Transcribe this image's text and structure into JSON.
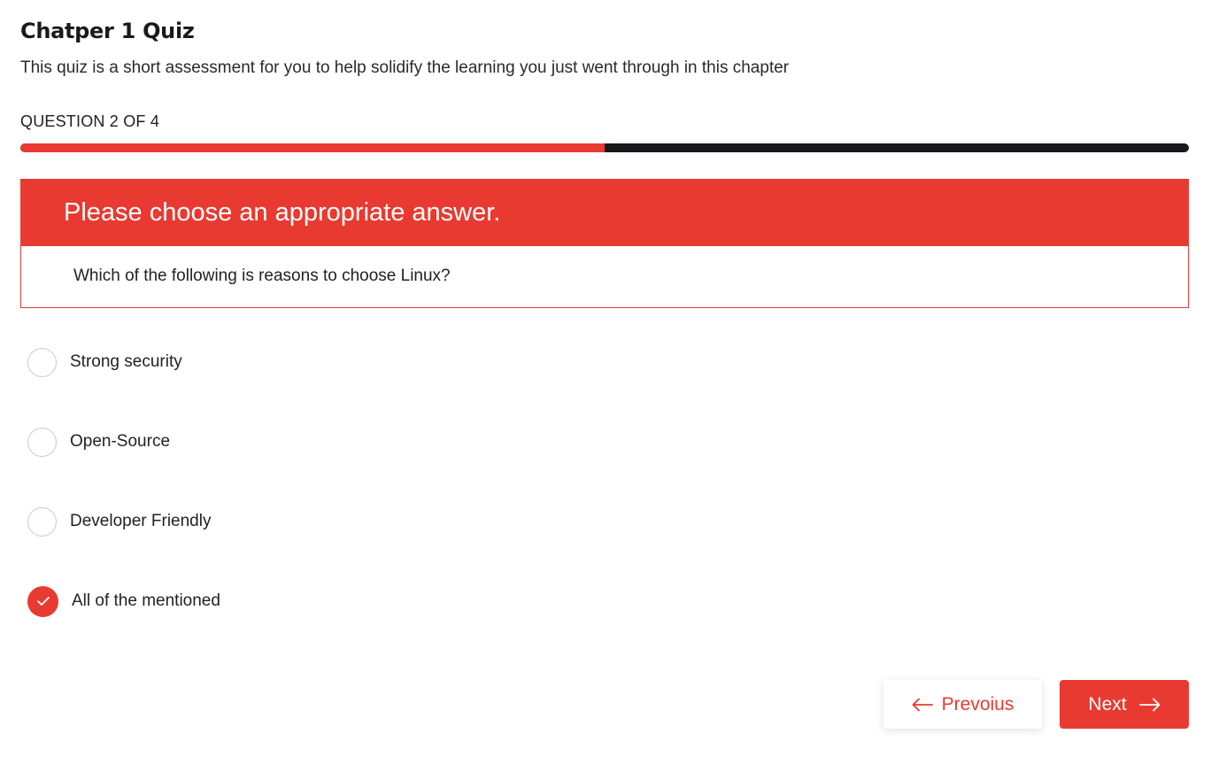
{
  "quiz": {
    "title": "Chatper 1 Quiz",
    "description": "This quiz is a short assessment for you to help solidify the learning you just went through in this chapter"
  },
  "progress": {
    "counter_text": "QUESTION 2 OF 4",
    "fraction": 0.5
  },
  "question": {
    "instruction": "Please choose an appropriate answer.",
    "text": "Which of the following is reasons to choose Linux?"
  },
  "options": [
    {
      "label": "Strong security",
      "selected": false
    },
    {
      "label": "Open-Source",
      "selected": false
    },
    {
      "label": "Developer Friendly",
      "selected": false
    },
    {
      "label": "All of the mentioned",
      "selected": true
    }
  ],
  "navigation": {
    "previous_label": "Prevoius",
    "previous_icon": "arrow-left-icon",
    "next_label": "Next",
    "next_icon": "arrow-right-icon"
  },
  "colors": {
    "accent": "#e83a30",
    "track": "#17181b"
  }
}
